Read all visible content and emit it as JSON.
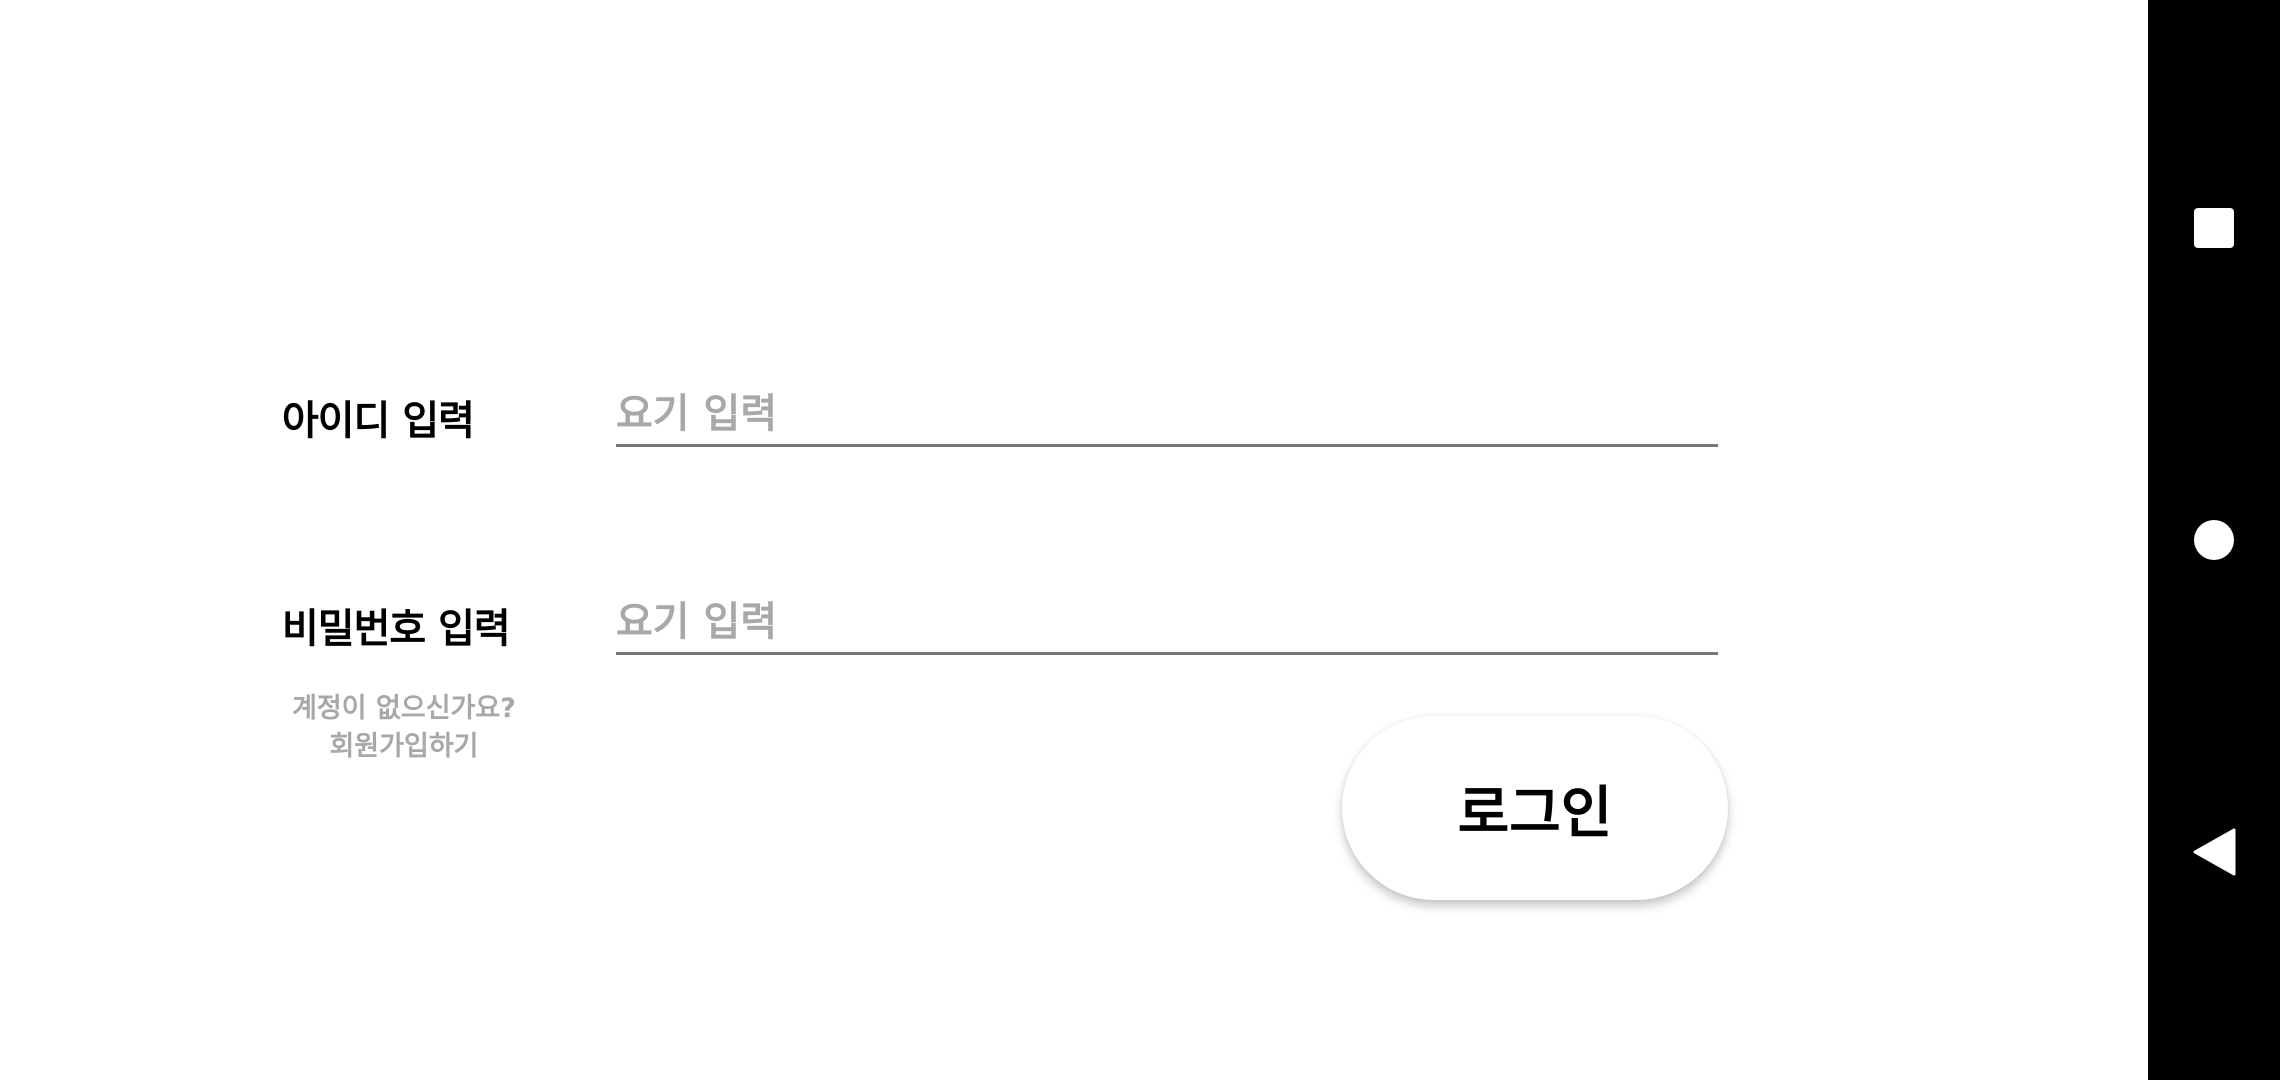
{
  "login_form": {
    "id_label": "아이디 입력",
    "id_placeholder": "요기 입력",
    "id_value": "",
    "password_label": "비밀번호 입력",
    "password_placeholder": "요기 입력",
    "password_value": "",
    "signup_line1": "계정이 없으신가요?",
    "signup_line2": "회원가입하기",
    "login_button": "로그인"
  },
  "system_nav": {
    "icons": [
      "recents-square-icon",
      "home-circle-icon",
      "back-triangle-icon"
    ]
  },
  "colors": {
    "background": "#ffffff",
    "label_text": "#000000",
    "placeholder_text": "#a8a8a8",
    "underline": "#777777",
    "nav_bar": "#000000"
  }
}
